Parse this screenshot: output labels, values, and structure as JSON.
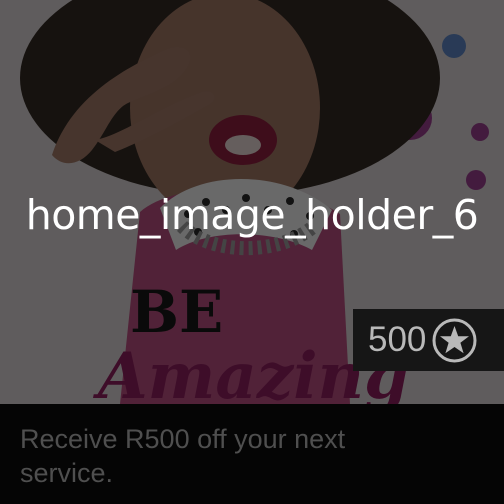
{
  "hero": {
    "image_label": "home_image_holder_6",
    "artwork_text": "BE Amazing"
  },
  "badge": {
    "points": "500",
    "icon": "star-icon"
  },
  "offer": {
    "description": "Receive R500 off your next service."
  }
}
